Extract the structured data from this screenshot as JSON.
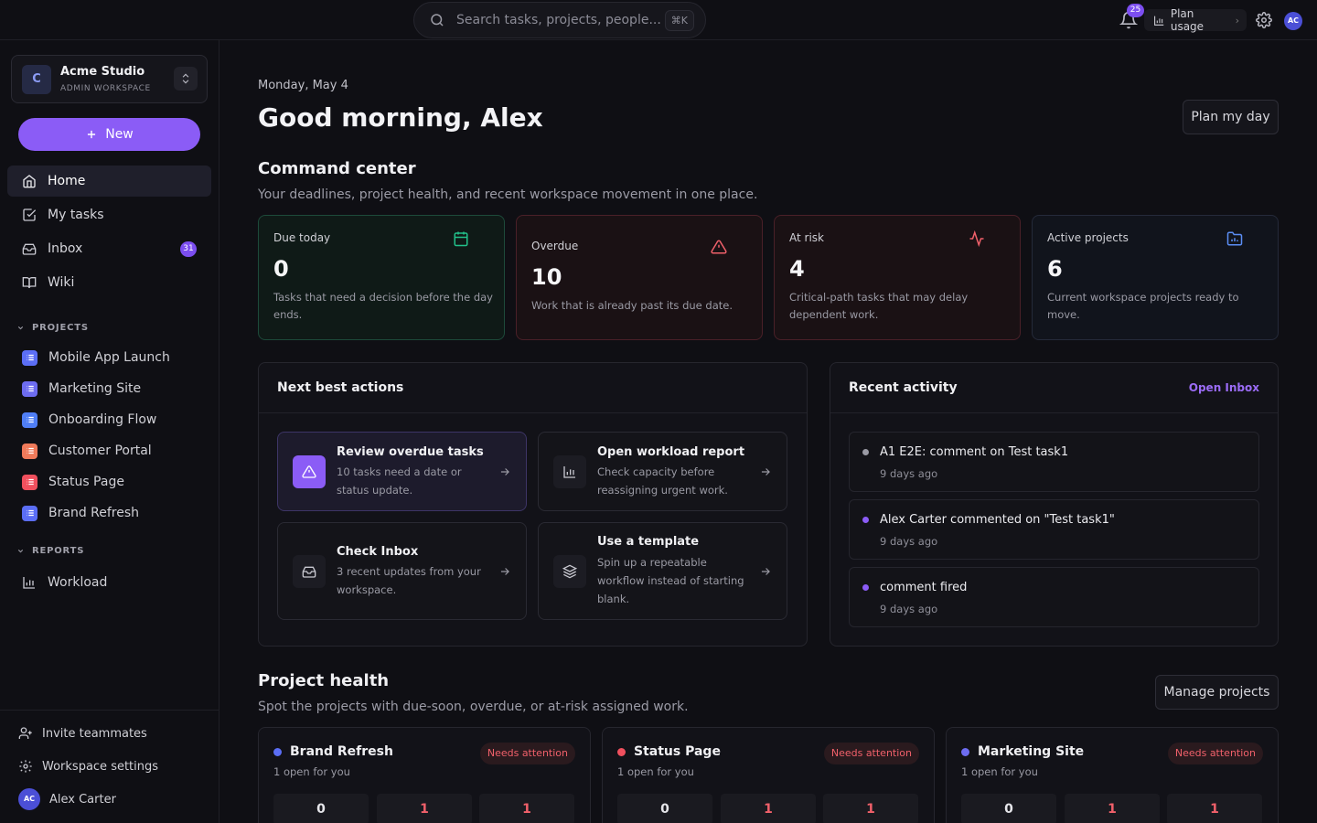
{
  "topbar": {
    "search_placeholder": "Search tasks, projects, people...",
    "search_shortcut": "⌘K",
    "notifications_count": "25",
    "plan_usage_label": "Plan usage",
    "user_initials": "AC"
  },
  "sidebar": {
    "workspace": {
      "initial": "C",
      "name": "Acme Studio",
      "role": "ADMIN WORKSPACE"
    },
    "new_label": "New",
    "nav": [
      {
        "label": "Home",
        "icon": "home-icon",
        "active": true
      },
      {
        "label": "My tasks",
        "icon": "check-square-icon"
      },
      {
        "label": "Inbox",
        "icon": "inbox-icon",
        "badge": "31"
      },
      {
        "label": "Wiki",
        "icon": "book-icon"
      }
    ],
    "projects_label": "PROJECTS",
    "projects": [
      {
        "label": "Mobile App Launch",
        "color": "#5b6ef5"
      },
      {
        "label": "Marketing Site",
        "color": "#6d6cf0"
      },
      {
        "label": "Onboarding Flow",
        "color": "#4f7ef5"
      },
      {
        "label": "Customer Portal",
        "color": "#f07a5a"
      },
      {
        "label": "Status Page",
        "color": "#f0505e"
      },
      {
        "label": "Brand Refresh",
        "color": "#5b6ef5"
      }
    ],
    "reports_label": "REPORTS",
    "reports": [
      {
        "label": "Workload"
      }
    ],
    "bottom": {
      "invite_label": "Invite teammates",
      "settings_label": "Workspace settings",
      "user_initials": "AC",
      "user_name": "Alex Carter"
    }
  },
  "main": {
    "date": "Monday, May 4",
    "greeting": "Good morning, Alex",
    "plan_day_label": "Plan my day",
    "command_center": {
      "title": "Command center",
      "description": "Your deadlines, project health, and recent workspace movement in one place."
    },
    "stats": [
      {
        "label": "Due today",
        "value": "0",
        "description": "Tasks that need a decision before the day ends.",
        "icon": "calendar-icon",
        "accent": "#22c08a"
      },
      {
        "label": "Overdue",
        "value": "10",
        "description": "Work that is already past its due date.",
        "icon": "warning-icon",
        "accent": "#f0606a"
      },
      {
        "label": "At risk",
        "value": "4",
        "description": "Critical-path tasks that may delay dependent work.",
        "icon": "pulse-icon",
        "accent": "#f0606a"
      },
      {
        "label": "Active projects",
        "value": "6",
        "description": "Current workspace projects ready to move.",
        "icon": "folder-icon",
        "accent": "#5b8ef5"
      }
    ],
    "next_actions": {
      "title": "Next best actions",
      "items": [
        {
          "title": "Review overdue tasks",
          "description": "10 tasks need a date or status update.",
          "icon": "warning-icon"
        },
        {
          "title": "Open workload report",
          "description": "Check capacity before reassigning urgent work.",
          "icon": "bar-chart-icon"
        },
        {
          "title": "Check Inbox",
          "description": "3 recent updates from your workspace.",
          "icon": "inbox-icon"
        },
        {
          "title": "Use a template",
          "description": "Spin up a repeatable workflow instead of starting blank.",
          "icon": "layers-icon"
        }
      ]
    },
    "recent_activity": {
      "title": "Recent activity",
      "open_inbox_label": "Open Inbox",
      "items": [
        {
          "text": "A1 E2E: comment on Test task1",
          "when": "9 days ago",
          "dot": "#9a9aa4"
        },
        {
          "text": "Alex Carter commented on \"Test task1\"",
          "when": "9 days ago",
          "dot": "#8b5cf6"
        },
        {
          "text": "comment fired",
          "when": "9 days ago",
          "dot": "#8b5cf6"
        }
      ]
    },
    "project_health": {
      "title": "Project health",
      "description": "Spot the projects with due-soon, overdue, or at-risk assigned work.",
      "manage_label": "Manage projects",
      "projects": [
        {
          "name": "Brand Refresh",
          "open": "1 open for you",
          "status": "Needs attention",
          "dot": "#5b6ef5",
          "counts": [
            "0",
            "1",
            "1"
          ]
        },
        {
          "name": "Status Page",
          "open": "1 open for you",
          "status": "Needs attention",
          "dot": "#f0505e",
          "counts": [
            "0",
            "1",
            "1"
          ]
        },
        {
          "name": "Marketing Site",
          "open": "1 open for you",
          "status": "Needs attention",
          "dot": "#6d6cf0",
          "counts": [
            "0",
            "1",
            "1"
          ]
        }
      ]
    }
  }
}
